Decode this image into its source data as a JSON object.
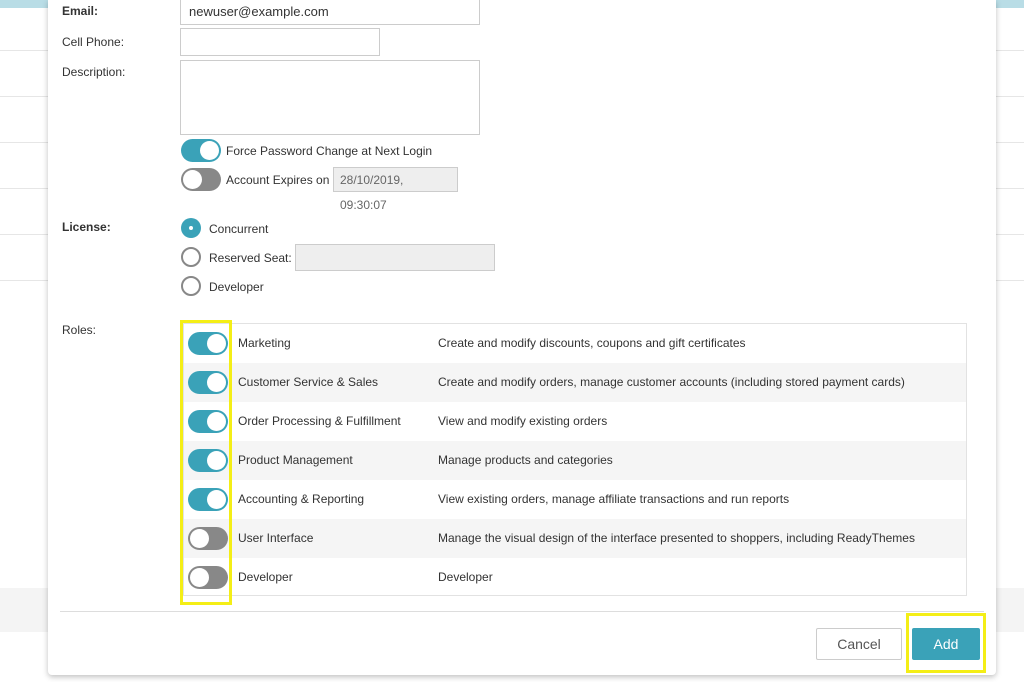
{
  "form": {
    "email": {
      "label": "Email:",
      "value": "newuser@example.com"
    },
    "cell_phone": {
      "label": "Cell Phone:",
      "value": ""
    },
    "description": {
      "label": "Description:",
      "value": ""
    },
    "force_password": {
      "label": "Force Password Change at Next Login",
      "enabled": true
    },
    "account_expires": {
      "label": "Account Expires on",
      "enabled": false,
      "value": "28/10/2019, 09:30:07"
    },
    "license": {
      "label": "License:",
      "options": [
        {
          "label": "Concurrent",
          "checked": true
        },
        {
          "label": "Reserved Seat:",
          "checked": false
        },
        {
          "label": "Developer",
          "checked": false
        }
      ],
      "reserved_seat_value": ""
    },
    "roles": {
      "label": "Roles:",
      "items": [
        {
          "name": "Marketing",
          "description": "Create and modify discounts, coupons and gift certificates",
          "enabled": true
        },
        {
          "name": "Customer Service & Sales",
          "description": "Create and modify orders, manage customer accounts (including stored payment cards)",
          "enabled": true
        },
        {
          "name": "Order Processing & Fulfillment",
          "description": "View and modify existing orders",
          "enabled": true
        },
        {
          "name": "Product Management",
          "description": "Manage products and categories",
          "enabled": true
        },
        {
          "name": "Accounting & Reporting",
          "description": "View existing orders, manage affiliate transactions and run reports",
          "enabled": true
        },
        {
          "name": "User Interface",
          "description": "Manage the visual design of the interface presented to shoppers, including ReadyThemes",
          "enabled": false
        },
        {
          "name": "Developer",
          "description": "Developer",
          "enabled": false
        }
      ]
    }
  },
  "footer": {
    "cancel_label": "Cancel",
    "add_label": "Add"
  },
  "colors": {
    "accent": "#3aa2b8",
    "toggle_off": "#888888",
    "highlight": "#f4ee16"
  }
}
